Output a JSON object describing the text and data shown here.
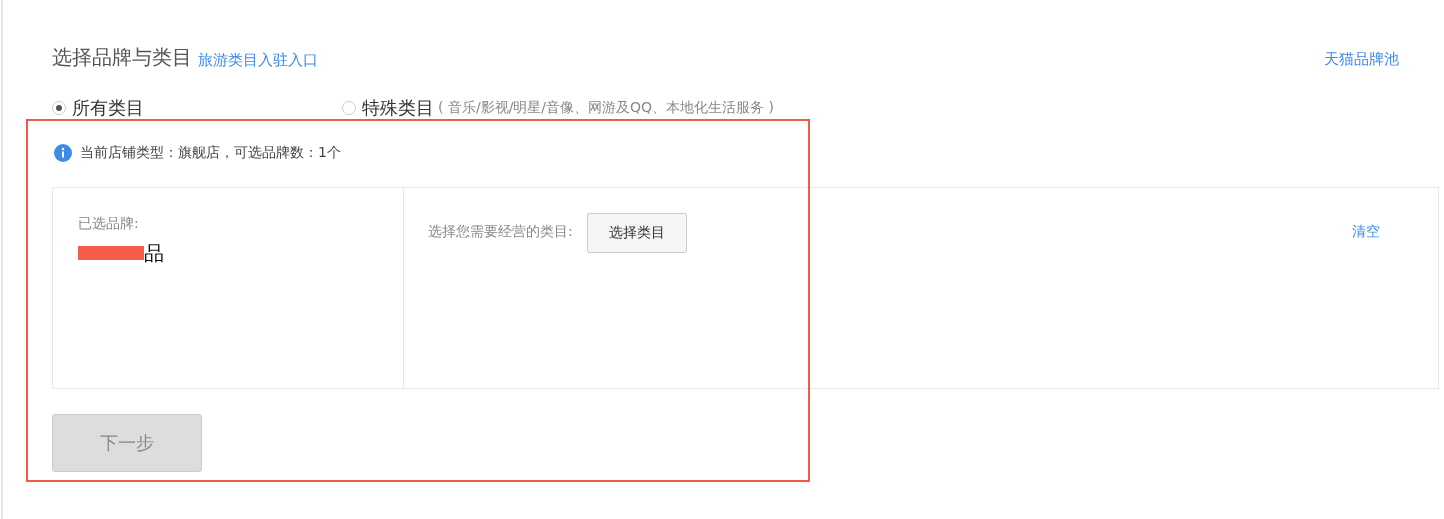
{
  "header": {
    "title": "选择品牌与类目",
    "entry_link": "旅游类目入驻入口",
    "brand_pool_link": "天猫品牌池"
  },
  "category_options": [
    {
      "label": "所有类目",
      "selected": true
    },
    {
      "label": "特殊类目",
      "note": "( 音乐/影视/明星/音像、网游及QQ、本地化生活服务 )",
      "selected": false
    }
  ],
  "notice": "当前店铺类型：旗舰店，可选品牌数：1个",
  "selected_brand": {
    "label": "已选品牌:",
    "name": "品",
    "redacted": true
  },
  "category_picker": {
    "prompt": "选择您需要经营的类目:",
    "button": "选择类目",
    "clear_link": "清空"
  },
  "next_button": {
    "label": "下一步",
    "disabled": true
  },
  "annotation_frame": true
}
